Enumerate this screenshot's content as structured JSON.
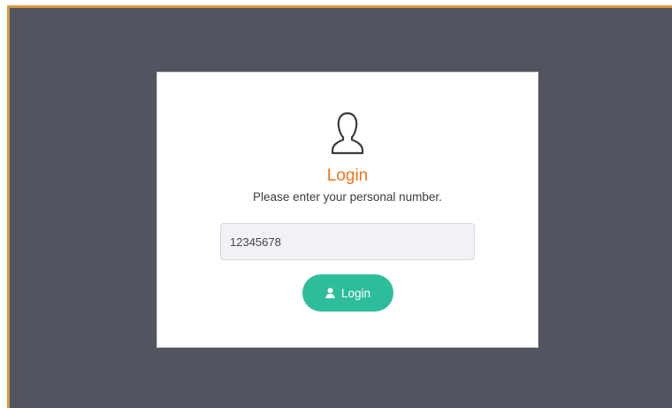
{
  "login": {
    "title": "Login",
    "subtitle": "Please enter your personal number.",
    "personal_number_value": "12345678",
    "button_label": "Login",
    "icons": {
      "header": "user-outline-icon",
      "button": "user-solid-icon"
    }
  },
  "colors": {
    "background": "#525560",
    "frame_border": "#d99a3c",
    "card": "#ffffff",
    "title": "#ee7412",
    "button": "#2ebd9c",
    "input_bg": "#f1f2f6"
  }
}
